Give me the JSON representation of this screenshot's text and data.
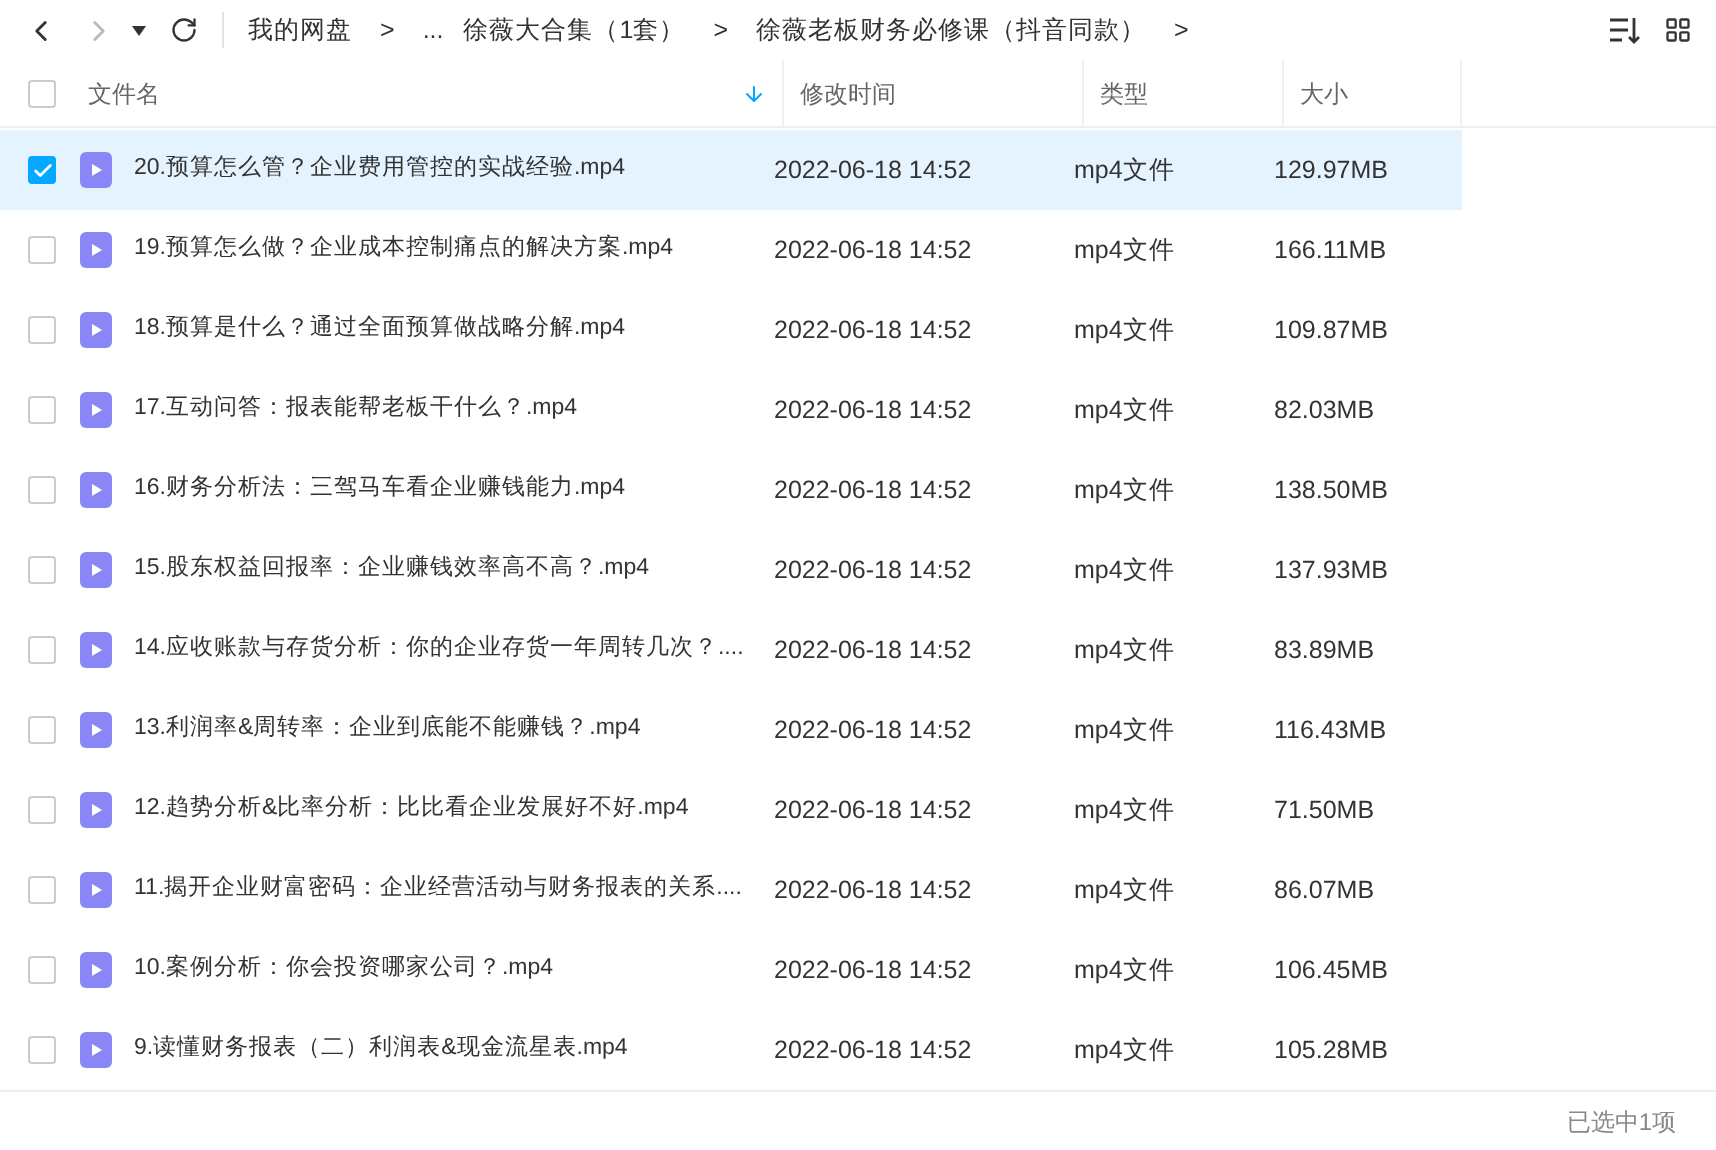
{
  "nav": {
    "breadcrumbs": [
      {
        "text": "我的网盘",
        "kind": "link"
      },
      {
        "text": ">",
        "kind": "sep"
      },
      {
        "text": "...",
        "kind": "link"
      },
      {
        "text": "徐薇大合集（1套）",
        "kind": "link"
      },
      {
        "text": ">",
        "kind": "sep"
      },
      {
        "text": "徐薇老板财务必修课（抖音同款）",
        "kind": "link"
      },
      {
        "text": ">",
        "kind": "sep"
      }
    ]
  },
  "table": {
    "select_all": {
      "checked": false
    },
    "columns": [
      {
        "label": "文件名",
        "sorted": true
      },
      {
        "label": "修改时间",
        "sorted": false
      },
      {
        "label": "类型",
        "sorted": false
      },
      {
        "label": "大小",
        "sorted": false
      }
    ],
    "rows": [
      {
        "name": "20.预算怎么管？企业费用管控的实战经验.mp4",
        "time": "2022-06-18 14:52",
        "type": "mp4文件",
        "size": "129.97MB",
        "selected": true
      },
      {
        "name": "19.预算怎么做？企业成本控制痛点的解决方案.mp4",
        "time": "2022-06-18 14:52",
        "type": "mp4文件",
        "size": "166.11MB",
        "selected": false
      },
      {
        "name": "18.预算是什么？通过全面预算做战略分解.mp4",
        "time": "2022-06-18 14:52",
        "type": "mp4文件",
        "size": "109.87MB",
        "selected": false
      },
      {
        "name": "17.互动问答：报表能帮老板干什么？.mp4",
        "time": "2022-06-18 14:52",
        "type": "mp4文件",
        "size": "82.03MB",
        "selected": false
      },
      {
        "name": "16.财务分析法：三驾马车看企业赚钱能力.mp4",
        "time": "2022-06-18 14:52",
        "type": "mp4文件",
        "size": "138.50MB",
        "selected": false
      },
      {
        "name": "15.股东权益回报率：企业赚钱效率高不高？.mp4",
        "time": "2022-06-18 14:52",
        "type": "mp4文件",
        "size": "137.93MB",
        "selected": false
      },
      {
        "name": "14.应收账款与存货分析：你的企业存货一年周转几次？....",
        "time": "2022-06-18 14:52",
        "type": "mp4文件",
        "size": "83.89MB",
        "selected": false
      },
      {
        "name": "13.利润率&周转率：企业到底能不能赚钱？.mp4",
        "time": "2022-06-18 14:52",
        "type": "mp4文件",
        "size": "116.43MB",
        "selected": false
      },
      {
        "name": "12.趋势分析&比率分析：比比看企业发展好不好.mp4",
        "time": "2022-06-18 14:52",
        "type": "mp4文件",
        "size": "71.50MB",
        "selected": false
      },
      {
        "name": "11.揭开企业财富密码：企业经营活动与财务报表的关系....",
        "time": "2022-06-18 14:52",
        "type": "mp4文件",
        "size": "86.07MB",
        "selected": false
      },
      {
        "name": "10.案例分析：你会投资哪家公司？.mp4",
        "time": "2022-06-18 14:52",
        "type": "mp4文件",
        "size": "106.45MB",
        "selected": false
      },
      {
        "name": "9.读懂财务报表（二）利润表&现金流星表.mp4",
        "time": "2022-06-18 14:52",
        "type": "mp4文件",
        "size": "105.28MB",
        "selected": false
      }
    ]
  },
  "status_bar": {
    "text": "已选中1项"
  }
}
